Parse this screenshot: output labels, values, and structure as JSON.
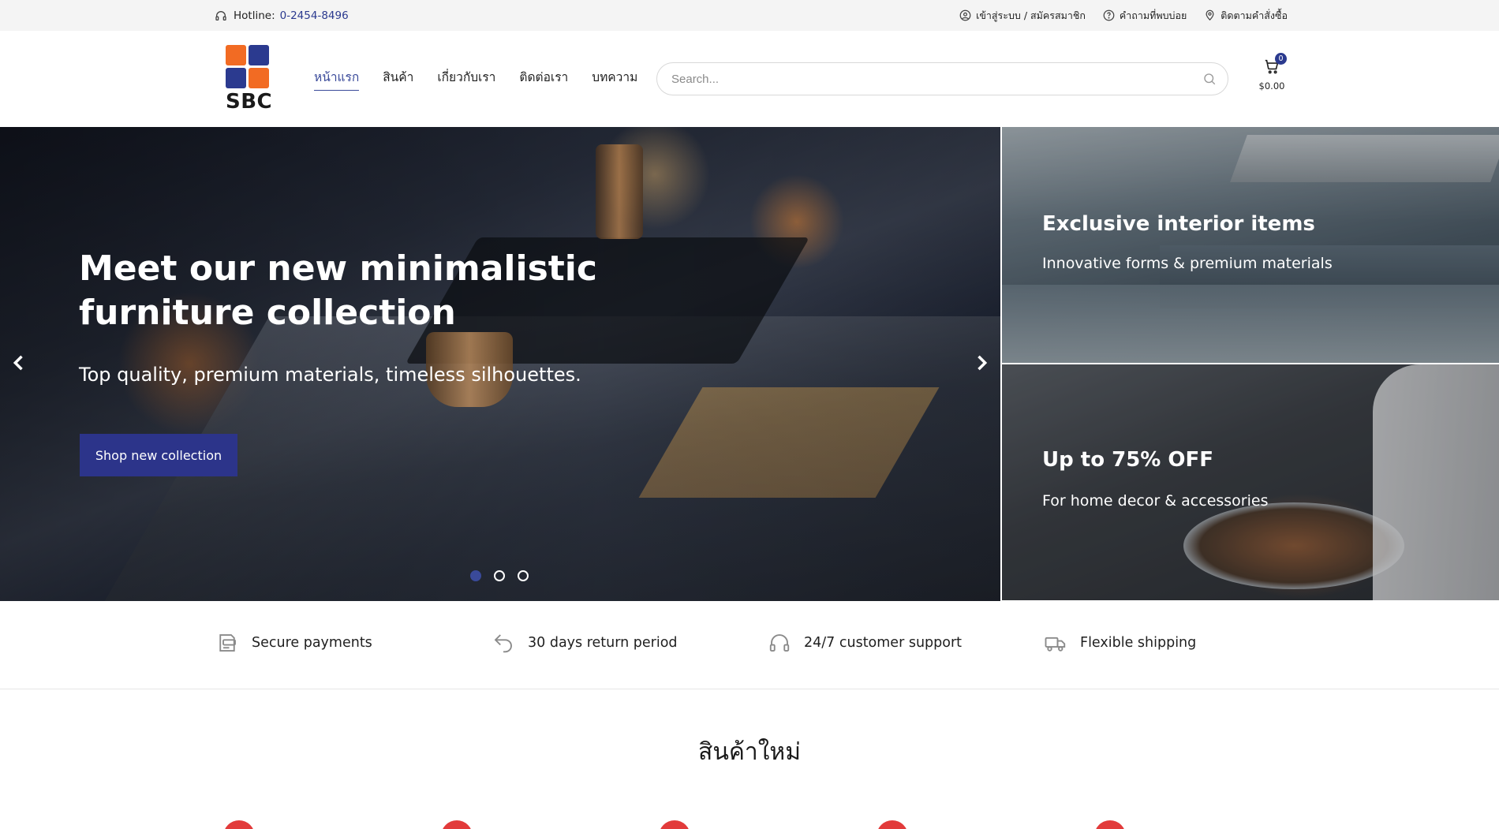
{
  "topbar": {
    "hotline_label": "Hotline:",
    "hotline_number": "0-2454-8496",
    "links": [
      {
        "label": "เข้าสู่ระบบ / สมัครสมาชิก",
        "icon": "user-circle-icon"
      },
      {
        "label": "คำถามที่พบบ่อย",
        "icon": "question-circle-icon"
      },
      {
        "label": "ติดตามคำสั่งซื้อ",
        "icon": "location-pin-icon"
      }
    ]
  },
  "header": {
    "logo_text": "SBC",
    "logo_colors": [
      "#f26b23",
      "#2b3a8f",
      "#2b3a8f",
      "#f26b23"
    ],
    "nav": [
      {
        "label": "หน้าแรก",
        "active": true
      },
      {
        "label": "สินค้า",
        "active": false
      },
      {
        "label": "เกี่ยวกับเรา",
        "active": false
      },
      {
        "label": "ติดต่อเรา",
        "active": false
      },
      {
        "label": "บทความ",
        "active": false
      }
    ],
    "search_placeholder": "Search...",
    "cart": {
      "count": "0",
      "total": "$0.00"
    }
  },
  "hero": {
    "title": "Meet our new minimalistic furniture collection",
    "subtitle": "Top quality, premium materials, timeless silhouettes.",
    "cta_label": "Shop new collection",
    "slides": 3,
    "active_slide": 1
  },
  "banners": [
    {
      "title": "Exclusive interior items",
      "subtitle": "Innovative forms & premium materials"
    },
    {
      "title": "Up to 75% OFF",
      "subtitle": "For home decor & accessories"
    }
  ],
  "features": [
    {
      "label": "Secure payments",
      "icon": "credit-card-icon"
    },
    {
      "label": "30 days return period",
      "icon": "return-arrow-icon"
    },
    {
      "label": "24/7 customer support",
      "icon": "headset-icon"
    },
    {
      "label": "Flexible shipping",
      "icon": "truck-icon"
    }
  ],
  "new_products": {
    "title": "สินค้าใหม่"
  },
  "colors": {
    "accent": "#2b3a8f",
    "brand_orange": "#f26b23",
    "sale_red": "#e23b3b"
  }
}
